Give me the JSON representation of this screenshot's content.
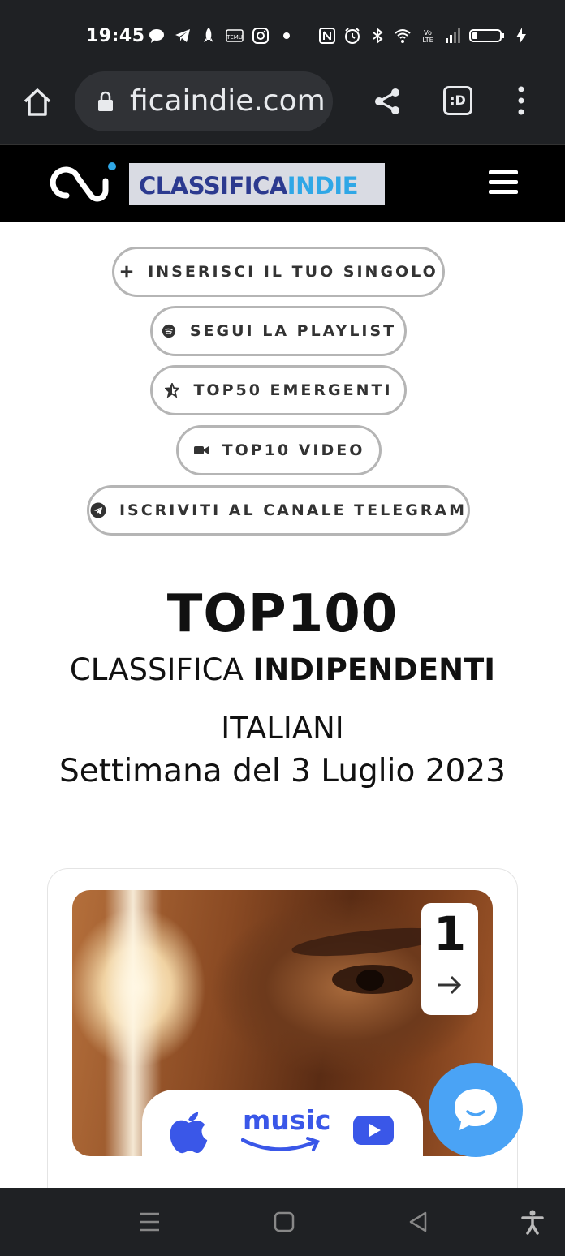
{
  "status_bar": {
    "time": "19:45",
    "left_icons": [
      "chat-bubble-icon",
      "telegram-icon",
      "rocket-icon",
      "temu-icon",
      "instagram-icon",
      "dot-icon"
    ],
    "right_icons": [
      "nfc-icon",
      "alarm-icon",
      "bluetooth-icon",
      "wifi-icon",
      "volte-icon",
      "signal-icon",
      "battery-icon",
      "charging-icon"
    ]
  },
  "browser": {
    "url": "ficaindie.com",
    "tabs_label": ":D"
  },
  "site": {
    "logo_part1": "CLASSIFICA",
    "logo_part2": "INDIE"
  },
  "buttons": [
    {
      "label": "INSERISCI IL TUO SINGOLO",
      "icon": "plus-icon"
    },
    {
      "label": "SEGUI LA PLAYLIST",
      "icon": "spotify-icon"
    },
    {
      "label": "TOP50 EMERGENTI",
      "icon": "star-icon"
    },
    {
      "label": "TOP10 VIDEO",
      "icon": "video-camera-icon"
    },
    {
      "label": "ISCRIVITI AL CANALE TELEGRAM",
      "icon": "telegram-icon"
    }
  ],
  "heading": {
    "title": "TOP100",
    "subtitle_normal": "CLASSIFICA ",
    "subtitle_bold": "INDIPENDENTI",
    "line3": "ITALIANI",
    "week": "Settimana del 3 Luglio 2023"
  },
  "card": {
    "rank": "1",
    "amazon_label": "music"
  },
  "colors": {
    "brand_dark": "#2c3a8f",
    "brand_light": "#2fa7e6",
    "chat": "#4aa3f5",
    "streaming_blue": "#3a57e8"
  }
}
